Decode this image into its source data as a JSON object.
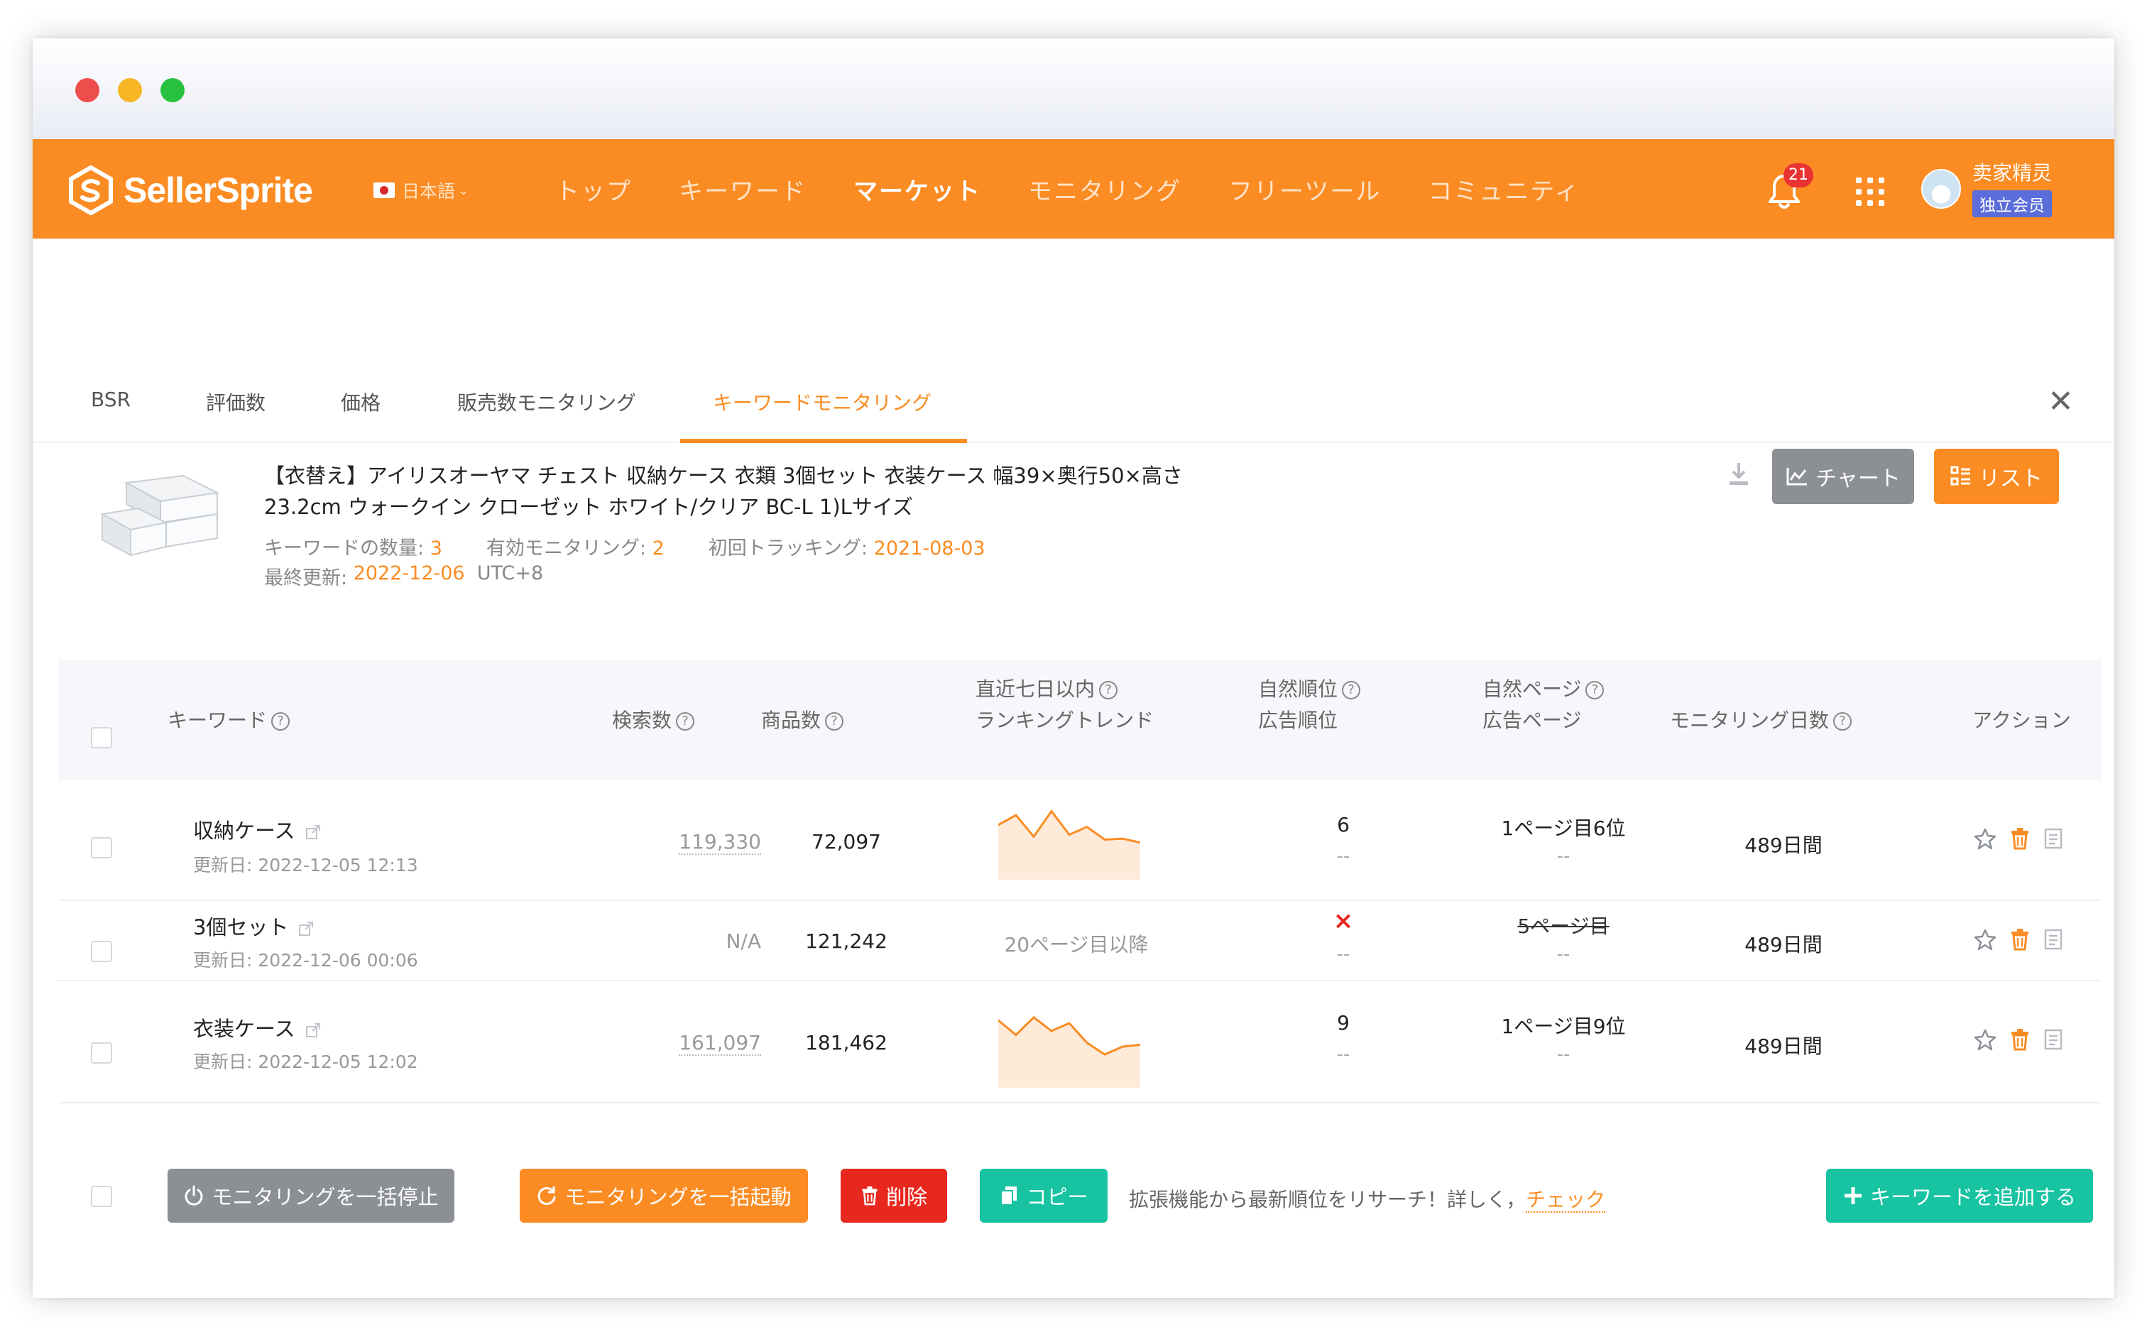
{
  "nav": {
    "logo_text": "SellerSprite",
    "language": "日本語",
    "menu": [
      "トップ",
      "キーワード",
      "マーケット",
      "モニタリング",
      "フリーツール",
      "コミュニティ"
    ],
    "active_menu": "マーケット",
    "notification_count": "21",
    "user_name": "卖家精灵",
    "member_badge": "独立会员"
  },
  "tabs": [
    "BSR",
    "評価数",
    "価格",
    "販売数モニタリング",
    "キーワードモニタリング"
  ],
  "active_tab": "キーワードモニタリング",
  "product": {
    "title": "【衣替え】アイリスオーヤマ チェスト 収納ケース 衣類 3個セット 衣装ケース 幅39×奥行50×高さ23.2cm ウォークイン クローゼット ホワイト/クリア BC-L 1)Lサイズ",
    "kw_count_label": "キーワードの数量:",
    "kw_count": "3",
    "active_label": "有効モニタリング:",
    "active_count": "2",
    "first_track_label": "初回トラッキング:",
    "first_track": "2021-08-03",
    "last_update_label": "最終更新:",
    "last_update": "2022-12-06",
    "tz": "UTC+8"
  },
  "buttons": {
    "chart": "チャート",
    "list": "リスト",
    "stop_all": "モニタリングを一括停止",
    "start_all": "モニタリングを一括起動",
    "delete": "削除",
    "copy": "コピー",
    "add_keyword": "キーワードを追加する"
  },
  "footer_note": "拡張機能から最新順位をリサーチ！詳しく，",
  "footer_check": "チェック",
  "table": {
    "headers": {
      "keyword": "キーワード",
      "search": "検索数",
      "products": "商品数",
      "trend_1": "直近七日以内",
      "trend_2": "ランキングトレンド",
      "organic_1": "自然順位",
      "organic_2": "広告順位",
      "page_1": "自然ページ",
      "page_2": "広告ページ",
      "days": "モニタリング日数",
      "action": "アクション"
    },
    "rows": [
      {
        "keyword": "収納ケース",
        "updated": "更新日: 2022-12-05 12:13",
        "search": "119,330",
        "products": "72,097",
        "trend": [
          18,
          8,
          30,
          4,
          28,
          20,
          33,
          32,
          36
        ],
        "organic": "6",
        "ad": "--",
        "page": "1ページ目6位",
        "ad_page": "--",
        "days": "489日間"
      },
      {
        "keyword": "3個セット",
        "updated": "更新日: 2022-12-06 00:06",
        "search": "N/A",
        "products": "121,242",
        "trend_text": "20ページ目以降",
        "organic": "×",
        "ad": "--",
        "page": "5ページ目",
        "ad_page": "--",
        "days": "489日間"
      },
      {
        "keyword": "衣装ケース",
        "updated": "更新日: 2022-12-05 12:02",
        "search": "161,097",
        "products": "181,462",
        "trend": [
          5,
          20,
          2,
          16,
          8,
          28,
          40,
          32,
          30
        ],
        "organic": "9",
        "ad": "--",
        "page": "1ページ目9位",
        "ad_page": "--",
        "days": "489日間"
      }
    ]
  },
  "colors": {
    "brand": "#fb8c23",
    "danger": "#e8281f",
    "teal": "#17c3a1",
    "gray_btn": "#8c8f94"
  }
}
